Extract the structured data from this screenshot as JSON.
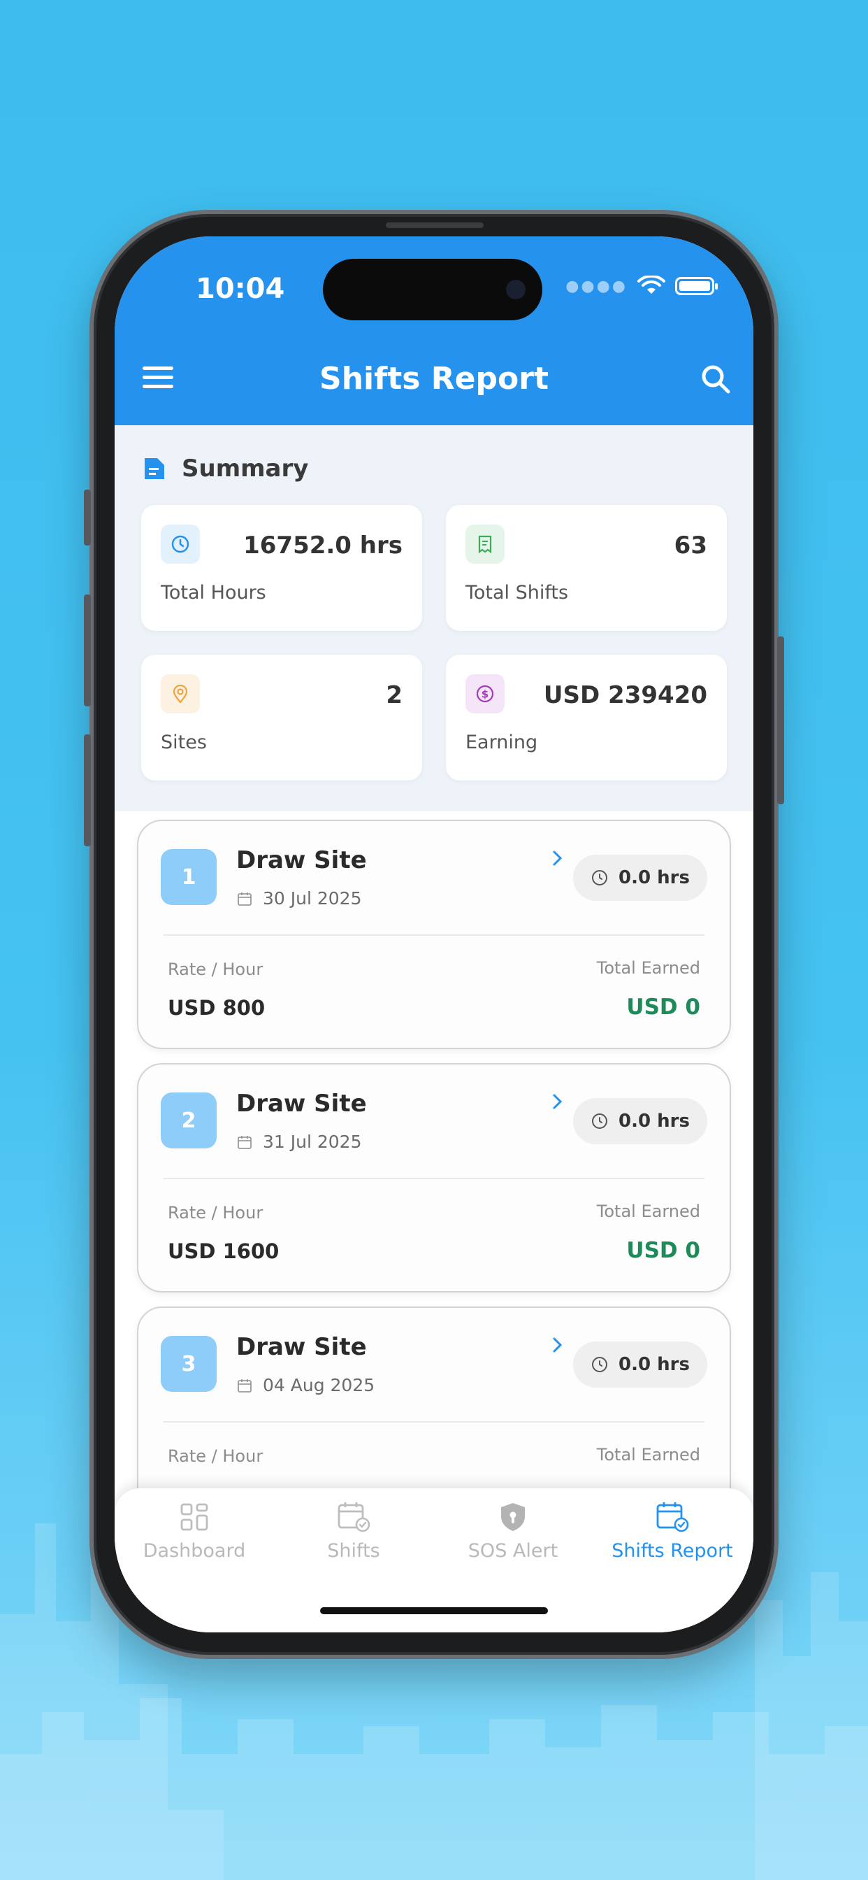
{
  "status_bar": {
    "time": "10:04"
  },
  "header": {
    "title": "Shifts Report"
  },
  "summary": {
    "title": "Summary",
    "stats": [
      {
        "value": "16752.0 hrs",
        "label": "Total Hours",
        "icon": "clock-icon",
        "color": "#2592ee"
      },
      {
        "value": "63",
        "label": "Total Shifts",
        "icon": "receipt-icon",
        "color": "#3faa5a"
      },
      {
        "value": "2",
        "label": "Sites",
        "icon": "location-pin-icon",
        "color": "#f2a23a"
      },
      {
        "value": "USD 239420",
        "label": "Earning",
        "icon": "dollar-icon",
        "color": "#a23bb5"
      }
    ]
  },
  "shifts": [
    {
      "number": "1",
      "site": "Draw Site",
      "date": "30 Jul 2025",
      "hours": "0.0 hrs",
      "rate_label": "Rate / Hour",
      "rate": "USD 800",
      "earned_label": "Total Earned",
      "earned": "USD 0"
    },
    {
      "number": "2",
      "site": "Draw Site",
      "date": "31 Jul 2025",
      "hours": "0.0 hrs",
      "rate_label": "Rate / Hour",
      "rate": "USD 1600",
      "earned_label": "Total Earned",
      "earned": "USD 0"
    },
    {
      "number": "3",
      "site": "Draw Site",
      "date": "04 Aug 2025",
      "hours": "0.0 hrs",
      "rate_label": "Rate / Hour",
      "rate": "",
      "earned_label": "Total Earned",
      "earned": ""
    }
  ],
  "bottom_nav": [
    {
      "label": "Dashboard",
      "icon": "dashboard-icon",
      "active": false
    },
    {
      "label": "Shifts",
      "icon": "calendar-icon",
      "active": false
    },
    {
      "label": "SOS Alert",
      "icon": "shield-icon",
      "active": false
    },
    {
      "label": "Shifts Report",
      "icon": "calendar-check-icon",
      "active": true
    }
  ],
  "colors": {
    "primary": "#2592ee",
    "earned": "#1e8a5a",
    "background": "#45c2f1"
  }
}
